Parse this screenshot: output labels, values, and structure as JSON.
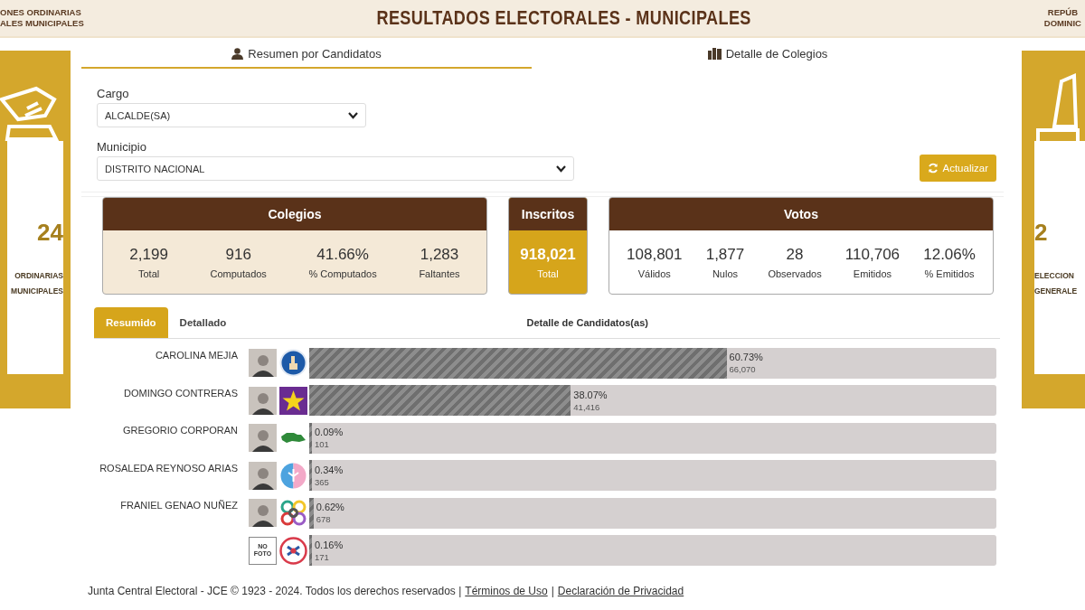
{
  "header": {
    "left_lines": [
      "ONES ORDINARIAS",
      "ALES MUNICIPALES"
    ],
    "title": "RESULTADOS ELECTORALES - MUNICIPALES",
    "right_lines": [
      "REPÚB",
      "DOMINIC"
    ]
  },
  "left_banner": {
    "year": "24",
    "lines": [
      "ORDINARIAS",
      "MUNICIPALES"
    ]
  },
  "right_banner": {
    "year": "2",
    "lines": [
      "ELECCION",
      "GENERALE"
    ]
  },
  "tabs": [
    {
      "label": "Resumen por Candidatos",
      "selected": true
    },
    {
      "label": "Detalle de Colegios",
      "selected": false
    }
  ],
  "filters": [
    {
      "label": "Cargo",
      "value": "ALCALDE(SA)"
    },
    {
      "label": "Municipio",
      "value": "DISTRITO NACIONAL"
    }
  ],
  "refresh_button": "Actualizar",
  "stat_cards": [
    {
      "title": "Colegios",
      "kind": "tinted",
      "stats": [
        {
          "value": "2,199",
          "label": "Total"
        },
        {
          "value": "916",
          "label": "Computados"
        },
        {
          "value": "41.66%",
          "label": "% Computados"
        },
        {
          "value": "1,283",
          "label": "Faltantes"
        }
      ]
    },
    {
      "title": "Inscritos",
      "kind": "featured",
      "stats": [
        {
          "value": "918,021",
          "label": "Total"
        }
      ]
    },
    {
      "title": "Votos",
      "kind": "plain",
      "stats": [
        {
          "value": "108,801",
          "label": "Válidos"
        },
        {
          "value": "1,877",
          "label": "Nulos"
        },
        {
          "value": "28",
          "label": "Observados"
        },
        {
          "value": "110,706",
          "label": "Emitidos"
        },
        {
          "value": "12.06%",
          "label": "% Emitidos"
        }
      ]
    }
  ],
  "view_tabs": [
    {
      "label": "Resumido",
      "selected": true
    },
    {
      "label": "Detallado",
      "selected": false
    }
  ],
  "results_title": "Detalle de Candidatos(as)",
  "candidates": [
    {
      "name": "CAROLINA MEJIA",
      "level": 0.6073,
      "percent": "60.73%",
      "votes": "66,070"
    },
    {
      "name": "DOMINGO CONTRERAS",
      "level": 0.3807,
      "percent": "38.07%",
      "votes": "41,416"
    },
    {
      "name": "GREGORIO CORPORAN",
      "level": 0.0009,
      "percent": "0.09%",
      "votes": "101"
    },
    {
      "name": "ROSALEDA REYNOSO ARIAS",
      "level": 0.0034,
      "percent": "0.34%",
      "votes": "365"
    },
    {
      "name": "FRANIEL GENAO NUÑEZ",
      "level": 0.0062,
      "percent": "0.62%",
      "votes": "678"
    },
    {
      "no_photo_label": "NO FOTO",
      "level": 0.0016,
      "percent": "0.16%",
      "votes": "171"
    }
  ],
  "footer": {
    "text": "Junta Central Electoral - JCE © 1923 - 2024. Todos los derechos reservados |",
    "links": [
      "Términos de Uso",
      "Declaración de Privacidad"
    ],
    "separator": "|"
  }
}
